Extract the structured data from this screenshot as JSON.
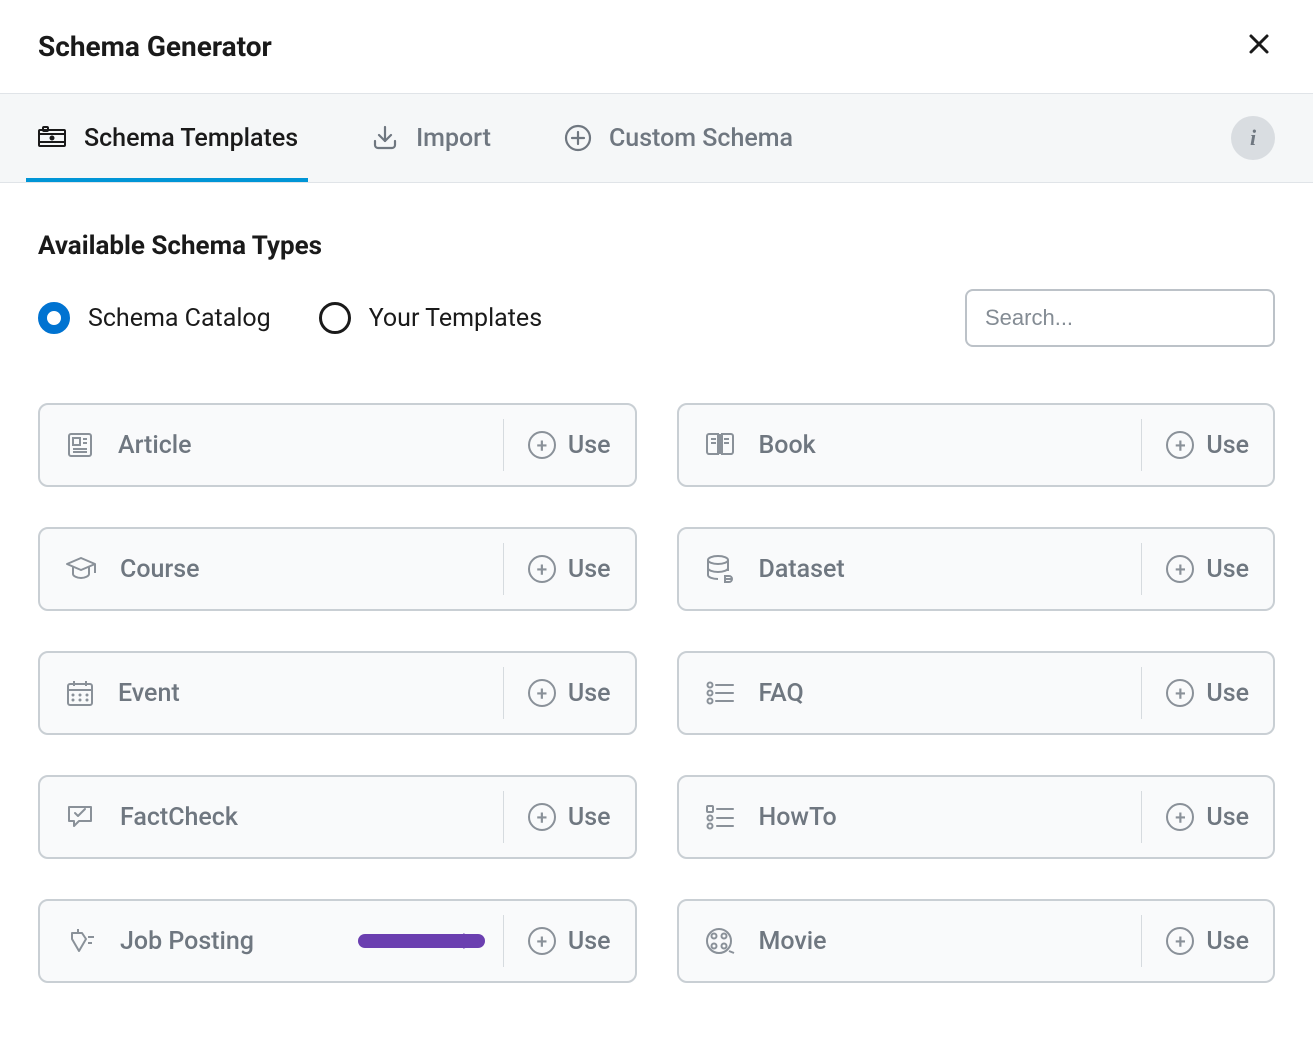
{
  "header": {
    "title": "Schema Generator"
  },
  "tabs": [
    {
      "id": "templates",
      "label": "Schema Templates",
      "active": true
    },
    {
      "id": "import",
      "label": "Import",
      "active": false
    },
    {
      "id": "custom",
      "label": "Custom Schema",
      "active": false
    }
  ],
  "section_title": "Available Schema Types",
  "radios": {
    "catalog": {
      "label": "Schema Catalog",
      "checked": true
    },
    "templates": {
      "label": "Your Templates",
      "checked": false
    }
  },
  "search": {
    "placeholder": "Search..."
  },
  "use_label": "Use",
  "cards": [
    {
      "id": "article",
      "label": "Article"
    },
    {
      "id": "book",
      "label": "Book"
    },
    {
      "id": "course",
      "label": "Course"
    },
    {
      "id": "dataset",
      "label": "Dataset"
    },
    {
      "id": "event",
      "label": "Event"
    },
    {
      "id": "faq",
      "label": "FAQ"
    },
    {
      "id": "factcheck",
      "label": "FactCheck"
    },
    {
      "id": "howto",
      "label": "HowTo"
    },
    {
      "id": "jobposting",
      "label": "Job Posting"
    },
    {
      "id": "movie",
      "label": "Movie"
    }
  ],
  "annotation": {
    "arrow_target": "jobposting"
  }
}
